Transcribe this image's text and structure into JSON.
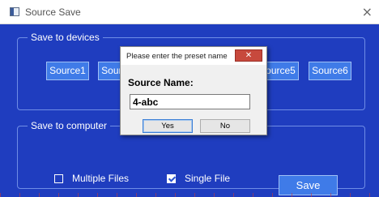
{
  "window": {
    "title": "Source Save",
    "close_glyph": "×",
    "icon": "app-window-icon"
  },
  "devices_group": {
    "legend": "Save to devices",
    "buttons": [
      {
        "label": "Source1"
      },
      {
        "label": "Source2"
      },
      {
        "label": "Source5"
      },
      {
        "label": "Source6"
      }
    ]
  },
  "computer_group": {
    "legend": "Save to computer",
    "options": [
      {
        "label": "Multiple Files",
        "checked": false
      },
      {
        "label": "Single File",
        "checked": true
      }
    ],
    "save_label": "Save"
  },
  "dialog": {
    "title": "Please enter the preset name",
    "close_glyph": "✕",
    "field_label": "Source Name:",
    "field_value": "4-abc",
    "yes_label": "Yes",
    "no_label": "No"
  },
  "colors": {
    "client_background": "#1f3dbf",
    "button_background": "#3f7be8",
    "dialog_close": "#c7493d"
  }
}
